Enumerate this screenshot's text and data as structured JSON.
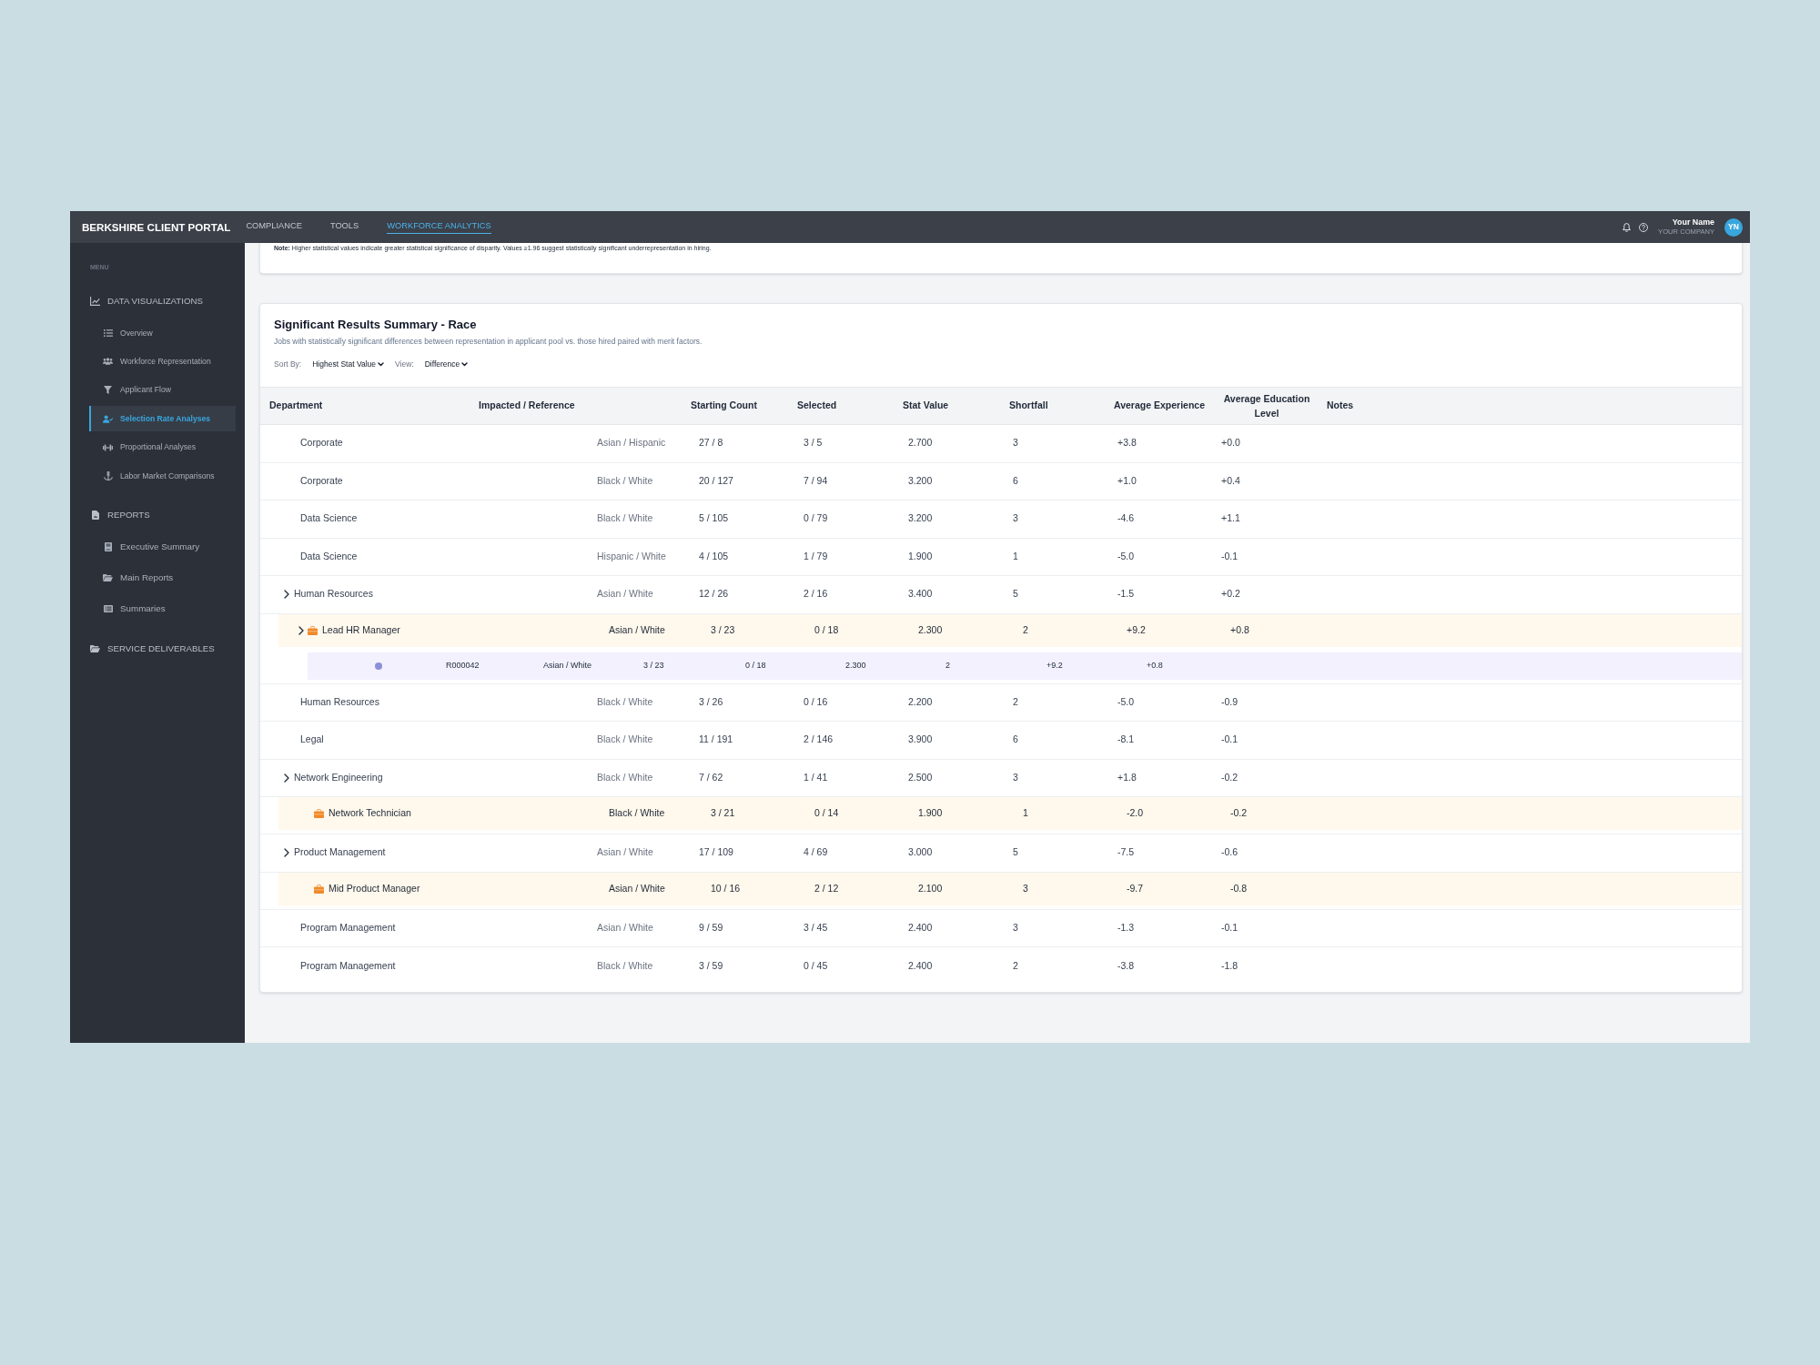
{
  "header": {
    "title": "BERKSHIRE CLIENT PORTAL",
    "nav": [
      {
        "label": "COMPLIANCE",
        "selected": false
      },
      {
        "label": "TOOLS",
        "selected": false
      },
      {
        "label": "WORKFORCE ANALYTICS",
        "selected": true
      }
    ],
    "user": {
      "name": "Your Name",
      "company": "YOUR COMPANY",
      "initials": "YN"
    }
  },
  "sidebar": {
    "heading": "MENU",
    "sections": [
      {
        "label": "DATA VISUALIZATIONS",
        "items": [
          {
            "label": "Overview",
            "selected": false
          },
          {
            "label": "Workforce Representation",
            "selected": false
          },
          {
            "label": "Applicant Flow",
            "selected": false
          },
          {
            "label": "Selection Rate Analyses",
            "selected": true
          },
          {
            "label": "Proportional Analyses",
            "selected": false
          },
          {
            "label": "Labor Market Comparisons",
            "selected": false
          }
        ]
      },
      {
        "label": "REPORTS",
        "items": [
          {
            "label": "Executive Summary",
            "selected": false
          },
          {
            "label": "Main Reports",
            "selected": false
          },
          {
            "label": "Summaries",
            "selected": false
          }
        ]
      },
      {
        "label": "SERVICE DELIVERABLES"
      }
    ]
  },
  "note": "**Note:** Higher statistical values indicate greater statistical significance of disparity. Values ≥1.96 suggest statistically significant underrepresentation in hiring.",
  "summary": {
    "title": "Significant Results Summary - Race",
    "subtitle": "Jobs with statistically significant differences between representation in applicant pool vs. those hired paired with merit factors.",
    "sort": {
      "label": "Sort By:",
      "value": "Highest Stat Value"
    },
    "view": {
      "label": "View:",
      "value": "Difference"
    },
    "table": {
      "columns": [
        "Department",
        "Impacted / Reference",
        "Starting Count",
        "Selected",
        "Stat Value",
        "Shortfall",
        "Average Experience",
        "Average Education Level",
        "Notes"
      ],
      "rows": [
        {
          "kind": "department",
          "name": "Corporate",
          "groups": "Asian / Hispanic",
          "starting_count": "27 / 8",
          "selected_count": "3 / 5",
          "stat_value": "2.700",
          "shortfall": "3",
          "average_experience": "+3.8",
          "average_education_level": "+0.0"
        },
        {
          "kind": "department",
          "name": "Corporate",
          "groups": "Black / White",
          "starting_count": "20 / 127",
          "selected_count": "7 / 94",
          "stat_value": "3.200",
          "shortfall": "6",
          "average_experience": "+1.0",
          "average_education_level": "+0.4"
        },
        {
          "kind": "department",
          "name": "Data Science",
          "groups": "Black / White",
          "starting_count": "5 / 105",
          "selected_count": "0 / 79",
          "stat_value": "3.200",
          "shortfall": "3",
          "average_experience": "-4.6",
          "average_education_level": "+1.1"
        },
        {
          "kind": "department",
          "name": "Data Science",
          "groups": "Hispanic / White",
          "starting_count": "4 / 105",
          "selected_count": "1 / 79",
          "stat_value": "1.900",
          "shortfall": "1",
          "average_experience": "-5.0",
          "average_education_level": "-0.1"
        },
        {
          "kind": "department",
          "name": "Human Resources",
          "groups": "Asian / White",
          "starting_count": "12 / 26",
          "selected_count": "2 / 16",
          "stat_value": "3.400",
          "shortfall": "5",
          "average_experience": "-1.5",
          "average_education_level": "+0.2",
          "children": [
            {
              "kind": "job",
              "name": "Lead HR Manager",
              "groups": "Asian / White",
              "starting_count": "3 / 23",
              "selected_count": "0 / 18",
              "stat_value": "2.300",
              "shortfall": "2",
              "average_experience": "+9.2",
              "average_education_level": "+0.8",
              "children": [
                {
                  "kind": "requisition",
                  "name": "R000042",
                  "groups": "Asian / White",
                  "starting_count": "3 / 23",
                  "selected_count": "0 / 18",
                  "stat_value": "2.300",
                  "shortfall": "2",
                  "average_experience": "+9.2",
                  "average_education_level": "+0.8"
                }
              ]
            }
          ]
        },
        {
          "kind": "department",
          "name": "Human Resources",
          "groups": "Black / White",
          "starting_count": "3 / 26",
          "selected_count": "0 / 16",
          "stat_value": "2.200",
          "shortfall": "2",
          "average_experience": "-5.0",
          "average_education_level": "-0.9"
        },
        {
          "kind": "department",
          "name": "Legal",
          "groups": "Black / White",
          "starting_count": "11 / 191",
          "selected_count": "2 / 146",
          "stat_value": "3.900",
          "shortfall": "6",
          "average_experience": "-8.1",
          "average_education_level": "-0.1"
        },
        {
          "kind": "department",
          "name": "Network Engineering",
          "groups": "Black / White",
          "starting_count": "7 / 62",
          "selected_count": "1 / 41",
          "stat_value": "2.500",
          "shortfall": "3",
          "average_experience": "+1.8",
          "average_education_level": "-0.2",
          "children": [
            {
              "kind": "job",
              "name": "Network Technician",
              "groups": "Black / White",
              "starting_count": "3 / 21",
              "selected_count": "0 / 14",
              "stat_value": "1.900",
              "shortfall": "1",
              "average_experience": "-2.0",
              "average_education_level": "-0.2"
            }
          ]
        },
        {
          "kind": "department",
          "name": "Product Management",
          "groups": "Asian / White",
          "starting_count": "17 / 109",
          "selected_count": "4 / 69",
          "stat_value": "3.000",
          "shortfall": "5",
          "average_experience": "-7.5",
          "average_education_level": "-0.6",
          "children": [
            {
              "kind": "job",
              "name": "Mid Product Manager",
              "groups": "Asian / White",
              "starting_count": "10 / 16",
              "selected_count": "2 / 12",
              "stat_value": "2.100",
              "shortfall": "3",
              "average_experience": "-9.7",
              "average_education_level": "-0.8"
            }
          ]
        },
        {
          "kind": "department",
          "name": "Program Management",
          "groups": "Asian / White",
          "starting_count": "9 / 59",
          "selected_count": "3 / 45",
          "stat_value": "2.400",
          "shortfall": "3",
          "average_experience": "-1.3",
          "average_education_level": "-0.1"
        },
        {
          "kind": "department",
          "name": "Program Management",
          "groups": "Black / White",
          "starting_count": "3 / 59",
          "selected_count": "0 / 45",
          "stat_value": "2.400",
          "shortfall": "2",
          "average_experience": "-3.8",
          "average_education_level": "-1.8"
        }
      ]
    }
  }
}
